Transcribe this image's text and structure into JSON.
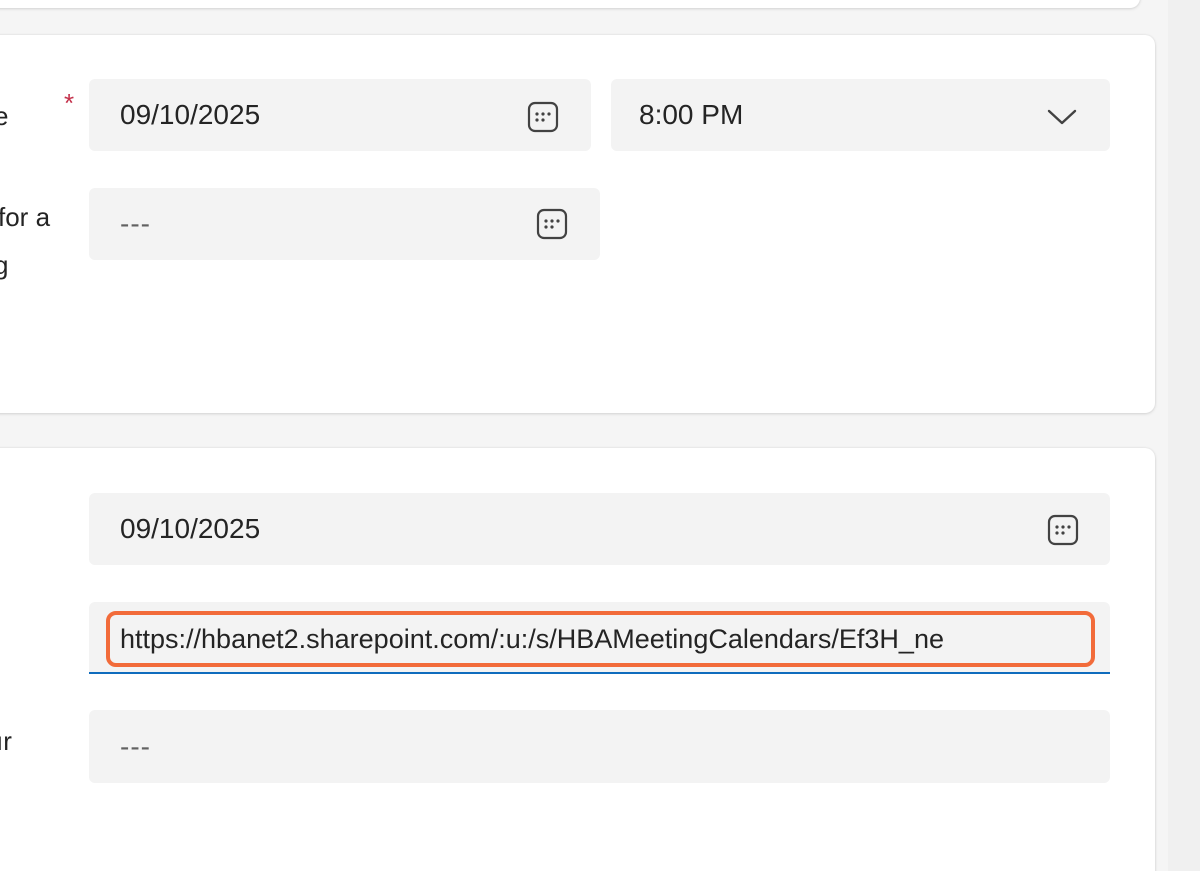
{
  "section_top": {
    "date_label_fragment": "e",
    "date_value": "09/10/2025",
    "time_value": "8:00 PM",
    "second_label_line1": "for a",
    "second_label_line2": "g",
    "second_field_value": "---"
  },
  "section_bottom": {
    "date_value": "09/10/2025",
    "url_value": "https://hbanet2.sharepoint.com/:u:/s/HBAMeetingCalendars/Ef3H_ne",
    "third_label_fragment": "ır",
    "third_field_value": "---"
  },
  "required_marker": "*",
  "colors": {
    "highlight": "#f26b3a",
    "focus_underline": "#0f6cbd",
    "required": "#c4314b"
  }
}
